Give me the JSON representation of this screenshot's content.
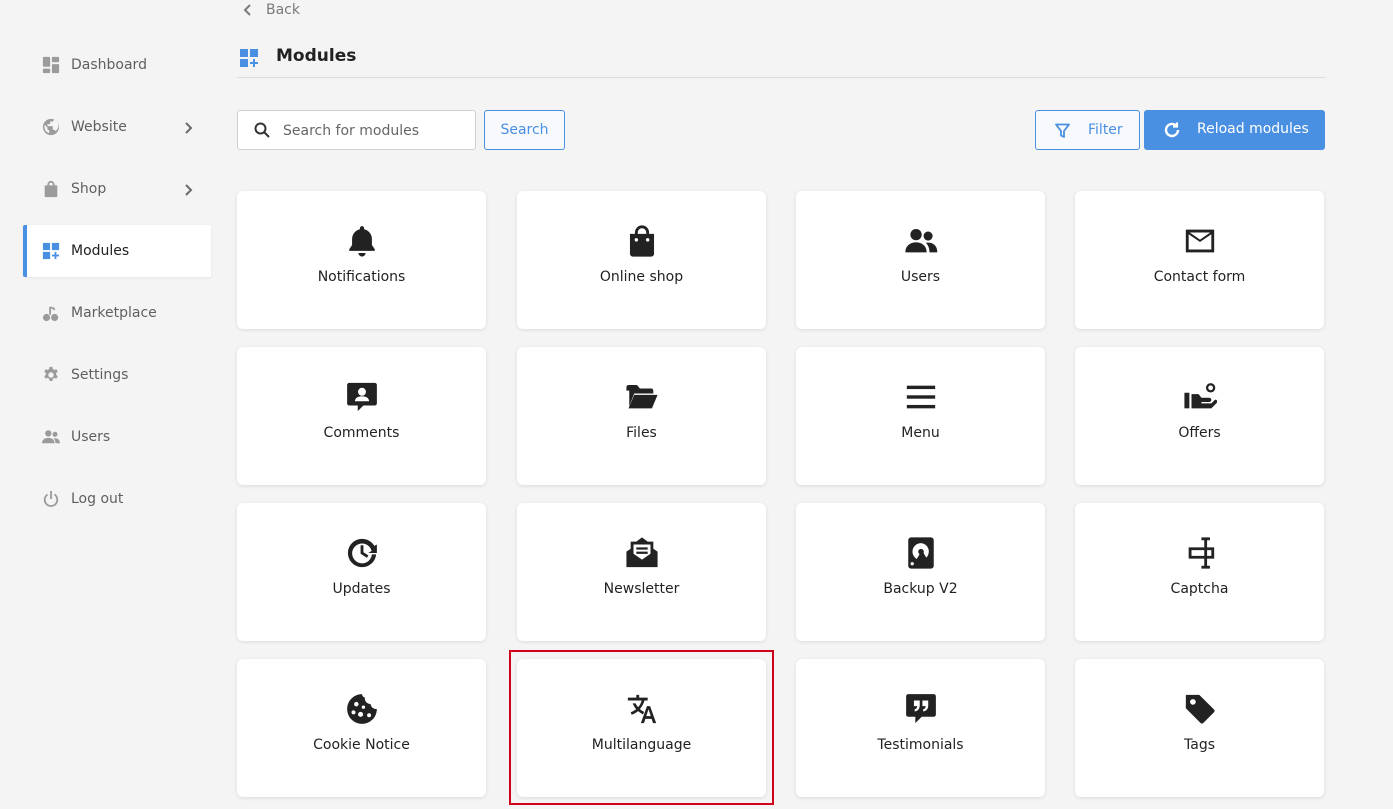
{
  "sidebar": {
    "items": [
      {
        "label": "Dashboard",
        "icon": "dashboard-icon",
        "chevron": false,
        "active": false
      },
      {
        "label": "Website",
        "icon": "globe-icon",
        "chevron": true,
        "active": false
      },
      {
        "label": "Shop",
        "icon": "shopping-bag-icon",
        "chevron": true,
        "active": false
      },
      {
        "label": "Modules",
        "icon": "modules-icon",
        "chevron": false,
        "active": true
      },
      {
        "label": "Marketplace",
        "icon": "marketplace-icon",
        "chevron": false,
        "active": false
      },
      {
        "label": "Settings",
        "icon": "gear-icon",
        "chevron": false,
        "active": false
      },
      {
        "label": "Users",
        "icon": "users-icon",
        "chevron": false,
        "active": false
      },
      {
        "label": "Log out",
        "icon": "power-icon",
        "chevron": false,
        "active": false
      }
    ]
  },
  "header": {
    "back_label": "Back",
    "title": "Modules"
  },
  "toolbar": {
    "search_placeholder": "Search for modules",
    "search_value": "",
    "search_button": "Search",
    "filter_button": "Filter",
    "reload_button": "Reload modules"
  },
  "colors": {
    "accent": "#4a90e2",
    "background": "#f4f4f4",
    "highlight": "#d0021b"
  },
  "modules": [
    {
      "label": "Notifications",
      "icon": "bell-icon"
    },
    {
      "label": "Online shop",
      "icon": "shopping-bag-icon"
    },
    {
      "label": "Users",
      "icon": "users-icon"
    },
    {
      "label": "Contact form",
      "icon": "envelope-icon"
    },
    {
      "label": "Comments",
      "icon": "comment-user-icon"
    },
    {
      "label": "Files",
      "icon": "folder-open-icon"
    },
    {
      "label": "Menu",
      "icon": "hamburger-icon"
    },
    {
      "label": "Offers",
      "icon": "hand-offer-icon"
    },
    {
      "label": "Updates",
      "icon": "clock-rotate-icon"
    },
    {
      "label": "Newsletter",
      "icon": "envelope-open-text-icon"
    },
    {
      "label": "Backup V2",
      "icon": "hard-drive-icon"
    },
    {
      "label": "Captcha",
      "icon": "captcha-icon"
    },
    {
      "label": "Cookie Notice",
      "icon": "cookie-icon"
    },
    {
      "label": "Multilanguage",
      "icon": "translate-icon"
    },
    {
      "label": "Testimonials",
      "icon": "quote-bubble-icon"
    },
    {
      "label": "Tags",
      "icon": "tag-icon"
    }
  ],
  "highlighted_module": "Multilanguage"
}
